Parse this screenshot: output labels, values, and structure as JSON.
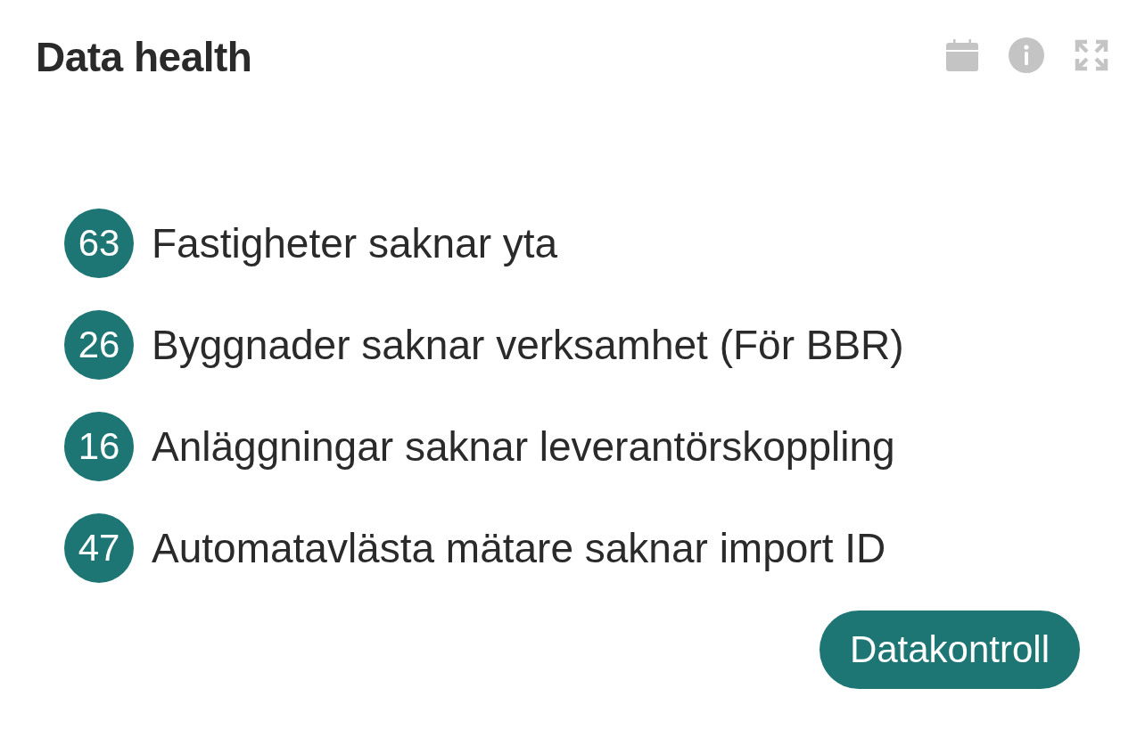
{
  "title": "Data health",
  "items": [
    {
      "count": "63",
      "label": "Fastigheter saknar yta"
    },
    {
      "count": "26",
      "label": "Byggnader saknar verksamhet (För BBR)"
    },
    {
      "count": "16",
      "label": "Anläggningar saknar leverantörskoppling"
    },
    {
      "count": "47",
      "label": "Automatavlästa mätare saknar import ID"
    }
  ],
  "button": {
    "label": "Datakontroll"
  }
}
